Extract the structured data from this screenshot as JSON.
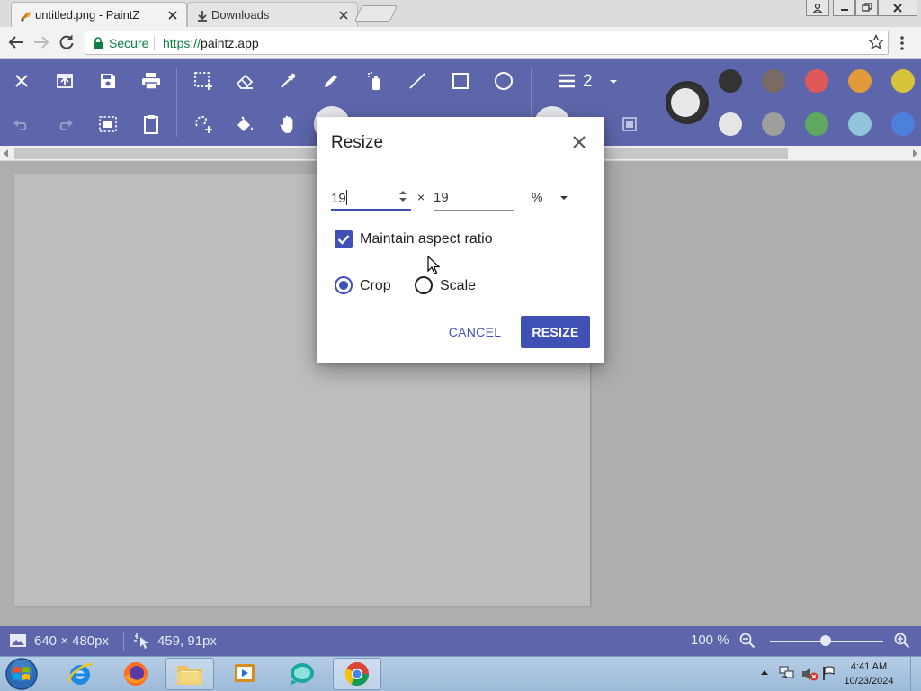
{
  "browser": {
    "tabs": [
      {
        "label": "untitled.png - PaintZ",
        "icon": "paintz-favicon"
      },
      {
        "label": "Downloads",
        "icon": "download-icon"
      }
    ],
    "address": {
      "security_label": "Secure",
      "url_scheme": "https://",
      "url_host": "paintz.app"
    }
  },
  "toolbar": {
    "line_width": "2",
    "palette": [
      "#333333",
      "#7a6a63",
      "#e05858",
      "#e29a3a",
      "#d8c43a",
      "#e6e6e6",
      "#9e9e9e",
      "#5ea860",
      "#8fc4dc",
      "#4d7fdc"
    ],
    "primary_color": "#333333",
    "secondary_color": "#e8e8e8"
  },
  "dialog": {
    "title": "Resize",
    "width_value": "19",
    "height_value": "19",
    "times": "×",
    "unit": "%",
    "maintain_aspect_label": "Maintain aspect ratio",
    "maintain_aspect_checked": true,
    "mode_options": [
      "Crop",
      "Scale"
    ],
    "mode_selected": "Crop",
    "cancel_label": "CANCEL",
    "resize_label": "RESIZE"
  },
  "status": {
    "canvas_size": "640 × 480px",
    "cursor_position": "459, 91px",
    "zoom": "100 %",
    "zoom_level": 100
  },
  "taskbar": {
    "time": "4:41 AM",
    "date": "10/23/2024"
  },
  "colors": {
    "accent": "#3f51b5",
    "toolbar": "#5d66aa"
  }
}
